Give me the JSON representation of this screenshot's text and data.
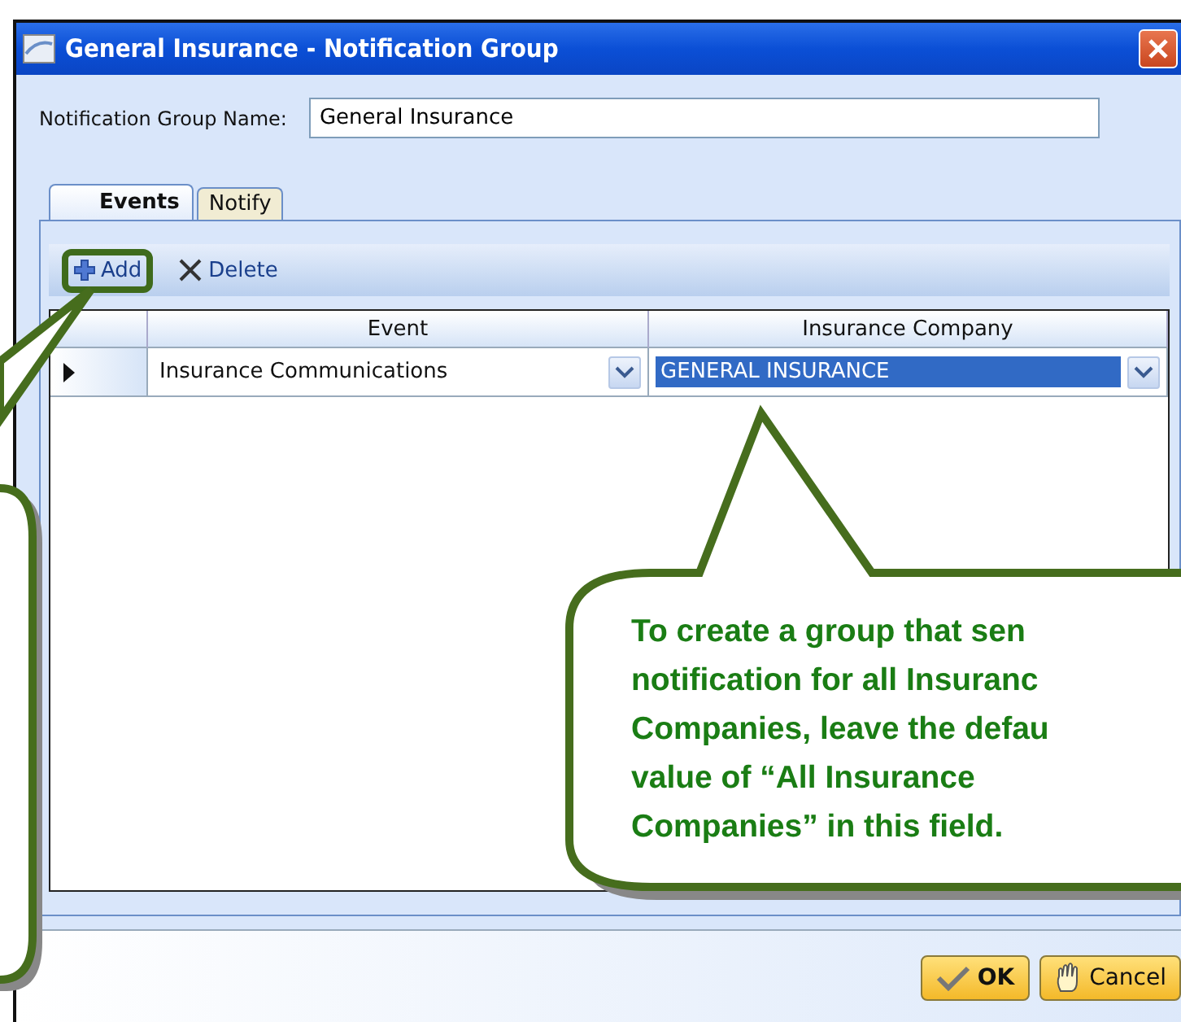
{
  "window": {
    "title": "General Insurance - Notification Group"
  },
  "name_field": {
    "label": "Notification Group Name:",
    "value": "General Insurance"
  },
  "tabs": [
    {
      "label": "Events",
      "selected": true
    },
    {
      "label": "Notify",
      "selected": false
    }
  ],
  "toolbar": [
    {
      "kind": "add",
      "label": "Add",
      "highlighted": true
    },
    {
      "kind": "delete",
      "label": "Delete",
      "highlighted": false
    }
  ],
  "grid": {
    "columns": [
      "Event",
      "Insurance Company"
    ],
    "rows": [
      {
        "current": true,
        "event": "Insurance Communications",
        "company": "GENERAL INSURANCE",
        "company_selected": true
      }
    ]
  },
  "callout": {
    "lines": [
      "To create a group that sen",
      "notification for all Insuranc",
      "Companies, leave the defau",
      "value of “All Insurance",
      "Companies” in this field."
    ]
  },
  "buttons": [
    {
      "kind": "ok",
      "label": "OK"
    },
    {
      "kind": "cancel",
      "label": "Cancel"
    }
  ]
}
